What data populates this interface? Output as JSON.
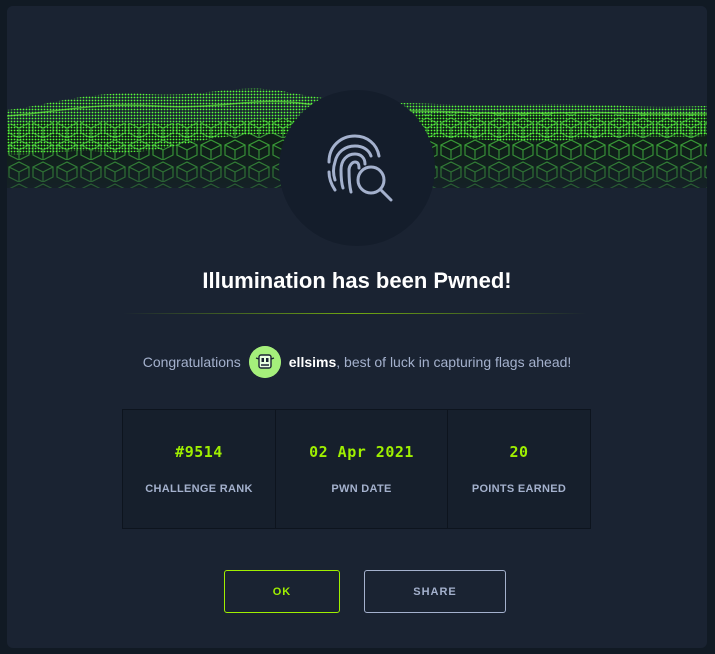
{
  "modal": {
    "title": "Illumination has been Pwned!",
    "congrats_prefix": "Congratulations",
    "username": "ellsims",
    "congrats_suffix": ", best of luck in capturing flags ahead!"
  },
  "stats": [
    {
      "value": "#9514",
      "label": "CHALLENGE RANK"
    },
    {
      "value": "02 Apr 2021",
      "label": "PWN DATE"
    },
    {
      "value": "20",
      "label": "POINTS EARNED"
    }
  ],
  "buttons": {
    "ok_label": "OK",
    "share_label": "SHARE"
  },
  "icons": {
    "emblem": "fingerprint-search-icon",
    "avatar": "user-avatar"
  },
  "colors": {
    "accent": "#9fef00",
    "modal_bg": "#1a2332",
    "emblem_bg": "#141d2b",
    "muted_text": "#a4b1cd",
    "avatar_bg": "#a5ef7b"
  }
}
